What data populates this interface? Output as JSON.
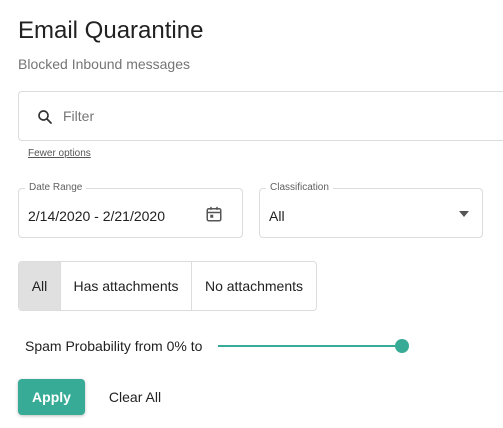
{
  "header": {
    "title": "Email Quarantine",
    "subtitle": "Blocked Inbound messages"
  },
  "filter": {
    "placeholder": "Filter",
    "value": "",
    "icon": "search-icon"
  },
  "fewer_options_label": "Fewer options",
  "date_range": {
    "label": "Date Range",
    "value": "2/14/2020 - 2/21/2020",
    "icon": "calendar-icon"
  },
  "classification": {
    "label": "Classification",
    "value": "All",
    "icon": "chevron-down-icon"
  },
  "attachments_filter": {
    "options": [
      "All",
      "Has attachments",
      "No attachments"
    ],
    "selected": "All"
  },
  "spam": {
    "label": "Spam Probability from 0% to",
    "slider_value": 1.0
  },
  "actions": {
    "apply_label": "Apply",
    "clear_label": "Clear All"
  },
  "colors": {
    "accent": "#38ab96",
    "selected_segment": "#e0e0e0",
    "border": "#dcdcdc"
  }
}
